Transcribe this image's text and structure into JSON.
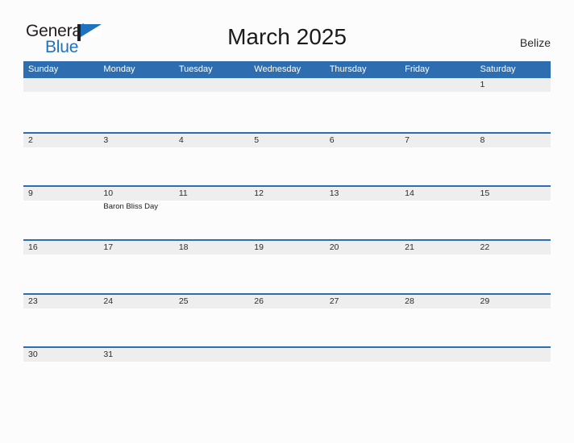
{
  "brand": {
    "word_one": "General",
    "word_two": "Blue",
    "flag_icon": "blue-flag-icon",
    "color_dark": "#231f20",
    "color_blue": "#1f72bd"
  },
  "header": {
    "title": "March 2025",
    "region": "Belize"
  },
  "colors": {
    "header_blue": "#2e6eb0",
    "row_band_gray": "#eeeeee",
    "page_background": "#fcfcfd",
    "text": "#2b2b2b"
  },
  "calendar": {
    "weekdays": [
      "Sunday",
      "Monday",
      "Tuesday",
      "Wednesday",
      "Thursday",
      "Friday",
      "Saturday"
    ],
    "weeks": [
      [
        {
          "day": "",
          "event": ""
        },
        {
          "day": "",
          "event": ""
        },
        {
          "day": "",
          "event": ""
        },
        {
          "day": "",
          "event": ""
        },
        {
          "day": "",
          "event": ""
        },
        {
          "day": "",
          "event": ""
        },
        {
          "day": "1",
          "event": ""
        }
      ],
      [
        {
          "day": "2",
          "event": ""
        },
        {
          "day": "3",
          "event": ""
        },
        {
          "day": "4",
          "event": ""
        },
        {
          "day": "5",
          "event": ""
        },
        {
          "day": "6",
          "event": ""
        },
        {
          "day": "7",
          "event": ""
        },
        {
          "day": "8",
          "event": ""
        }
      ],
      [
        {
          "day": "9",
          "event": ""
        },
        {
          "day": "10",
          "event": "Baron Bliss Day"
        },
        {
          "day": "11",
          "event": ""
        },
        {
          "day": "12",
          "event": ""
        },
        {
          "day": "13",
          "event": ""
        },
        {
          "day": "14",
          "event": ""
        },
        {
          "day": "15",
          "event": ""
        }
      ],
      [
        {
          "day": "16",
          "event": ""
        },
        {
          "day": "17",
          "event": ""
        },
        {
          "day": "18",
          "event": ""
        },
        {
          "day": "19",
          "event": ""
        },
        {
          "day": "20",
          "event": ""
        },
        {
          "day": "21",
          "event": ""
        },
        {
          "day": "22",
          "event": ""
        }
      ],
      [
        {
          "day": "23",
          "event": ""
        },
        {
          "day": "24",
          "event": ""
        },
        {
          "day": "25",
          "event": ""
        },
        {
          "day": "26",
          "event": ""
        },
        {
          "day": "27",
          "event": ""
        },
        {
          "day": "28",
          "event": ""
        },
        {
          "day": "29",
          "event": ""
        }
      ],
      [
        {
          "day": "30",
          "event": ""
        },
        {
          "day": "31",
          "event": ""
        },
        {
          "day": "",
          "event": ""
        },
        {
          "day": "",
          "event": ""
        },
        {
          "day": "",
          "event": ""
        },
        {
          "day": "",
          "event": ""
        },
        {
          "day": "",
          "event": ""
        }
      ]
    ]
  }
}
